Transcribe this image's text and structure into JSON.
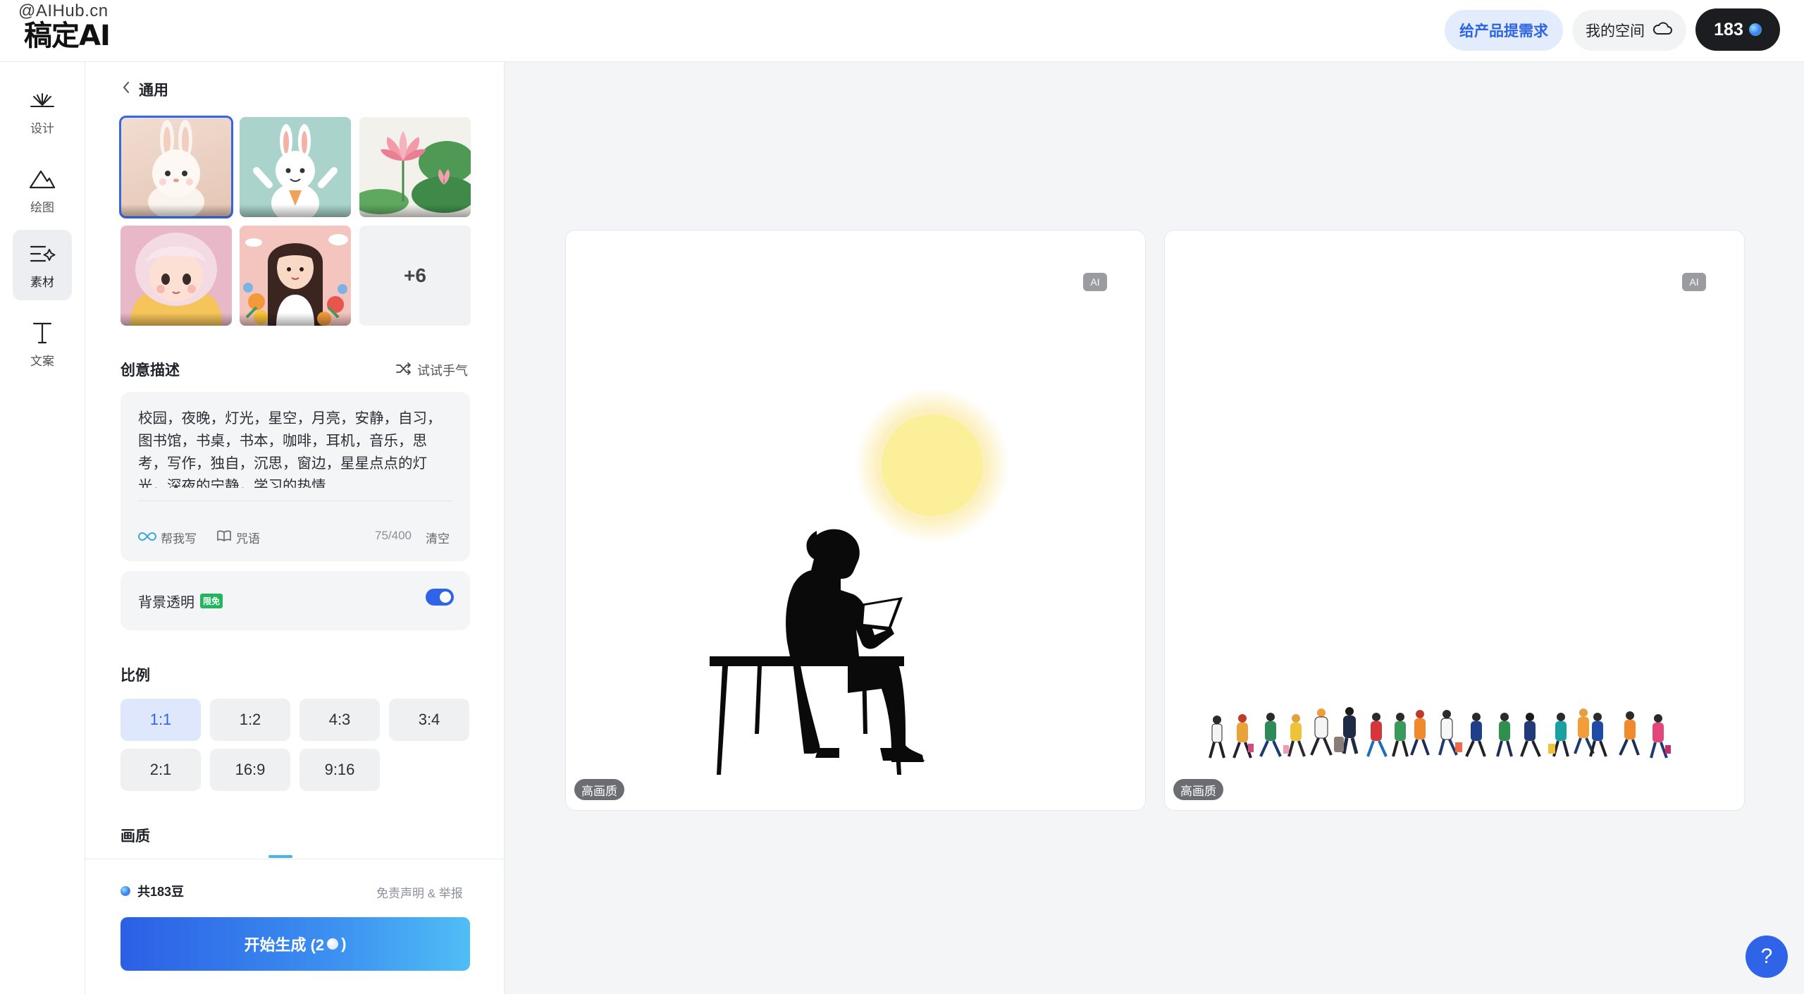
{
  "watermark": "@AIHub.cn",
  "brand": {
    "logo_text": "稿定AI"
  },
  "header": {
    "request_label": "给产品提需求",
    "my_space_label": "我的空间",
    "credits": "183"
  },
  "nav": [
    {
      "label": "设计",
      "icon": "design-icon"
    },
    {
      "label": "绘图",
      "icon": "mountain-icon"
    },
    {
      "label": "素材",
      "icon": "material-icon",
      "active": true
    },
    {
      "label": "文案",
      "icon": "text-icon"
    }
  ],
  "panel": {
    "back_label": "通用",
    "more_styles": "+6",
    "prompt": {
      "title": "创意描述",
      "try_luck": "试试手气",
      "text": "校园，夜晚，灯光，星空，月亮，安静，自习，图书馆，书桌，书本，咖啡，耳机，音乐，思考，写作，独自，沉思，窗边，星星点点的灯光，深夜的宁静，学习的热情",
      "help_write": "帮我写",
      "spell": "咒语",
      "count": "75/400",
      "clear": "清空"
    },
    "background": {
      "label": "背景透明",
      "badge": "限免",
      "enabled": true
    },
    "ratio": {
      "title": "比例",
      "options": [
        "1:1",
        "1:2",
        "4:3",
        "3:4",
        "2:1",
        "16:9",
        "9:16"
      ],
      "selected": "1:1"
    },
    "quality_title": "画质",
    "footer": {
      "beans_total": "共183豆",
      "disclaimer": "免责声明 & 举报",
      "generate_label": "开始生成 (2",
      "generate_suffix": ")"
    }
  },
  "results": [
    {
      "ai_tag": "AI",
      "quality_tag": "高画质"
    },
    {
      "ai_tag": "AI",
      "quality_tag": "高画质"
    }
  ],
  "help_label": "?"
}
